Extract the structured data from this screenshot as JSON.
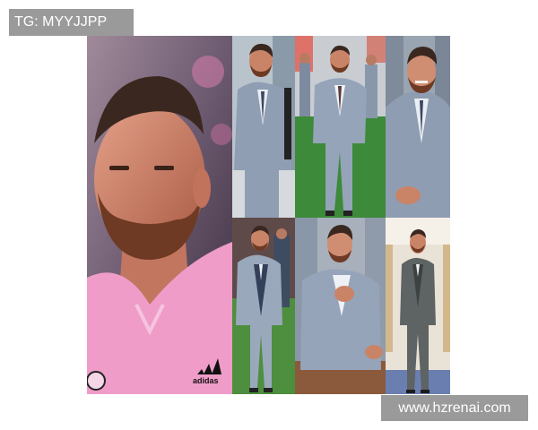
{
  "overlay_top": {
    "text": "TG: MYYJJPP"
  },
  "overlay_bottom": {
    "text": "www.hzrenai.com"
  },
  "jersey": {
    "brand_text": "adidas"
  },
  "colors": {
    "jersey_pink": "#ef9cc8",
    "suit_grey": "#8f9eb3",
    "grass_green": "#3c8a3a",
    "overlay_grey": "#9a9a9a"
  }
}
